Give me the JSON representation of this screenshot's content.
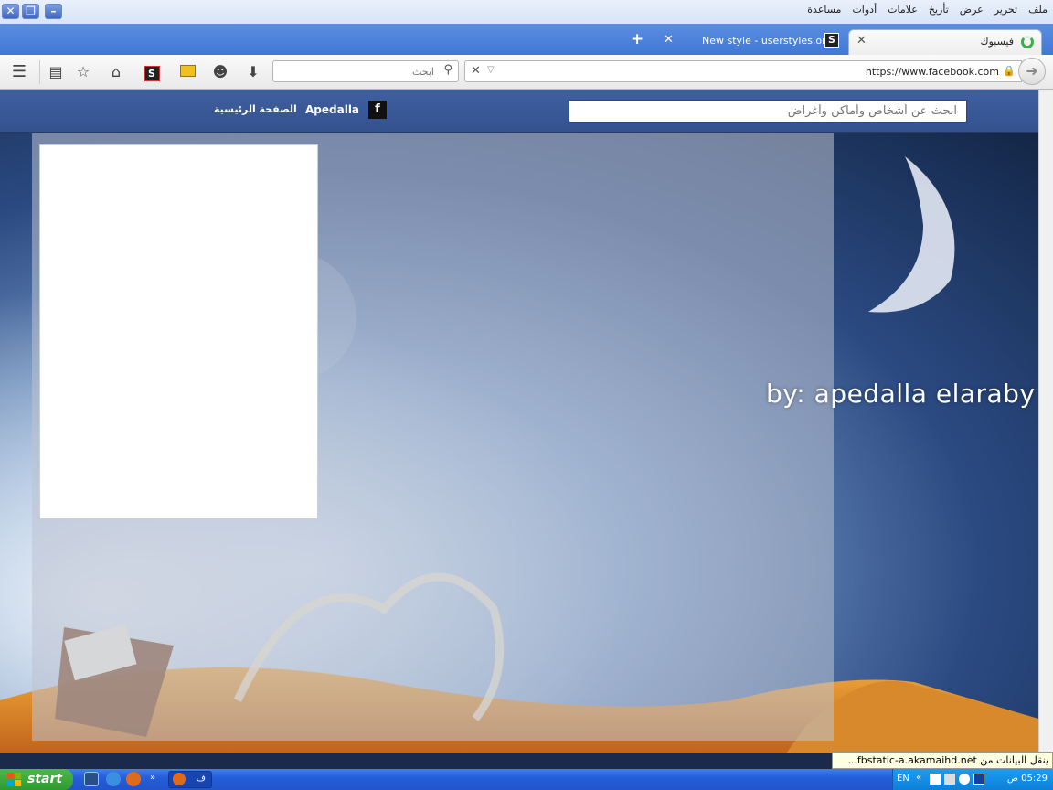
{
  "menubar": {
    "items": [
      "ملف",
      "تحرير",
      "عرض",
      "تأريخ",
      "علامات",
      "أدوات",
      "مساعدة"
    ]
  },
  "tabs": {
    "active_title": "فيسبوك",
    "inactive_title": "New style - userstyles.org",
    "new_tab": "+"
  },
  "navbar": {
    "search_placeholder": "ابحث",
    "url": "https://www.facebook.com"
  },
  "facebook": {
    "search_placeholder": "ابحث عن أشخاص وأماكن وأغراض",
    "logo": "f",
    "user_name": "Apedalla",
    "home_label": "الصفحة الرئيسية"
  },
  "scene": {
    "byline": "by: apedalla elaraby"
  },
  "status": {
    "text": "ينقل البيانات من fbstatic-a.akamaihd.net..."
  },
  "taskbar": {
    "start_label": "start",
    "task_label": "ف",
    "tray_lang": "EN",
    "clock": "05:29 ص"
  },
  "colors": {
    "fb_blue": "#3b5998",
    "taskbar_blue": "#245ed8",
    "start_green": "#3aaa3a"
  }
}
